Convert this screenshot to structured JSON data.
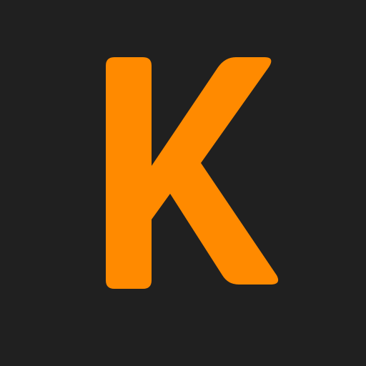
{
  "app_icon": {
    "letter": "K",
    "icon_name": "k-letter-logo-icon",
    "colors": {
      "background": "#202020",
      "letter": "#FF8A00"
    }
  }
}
